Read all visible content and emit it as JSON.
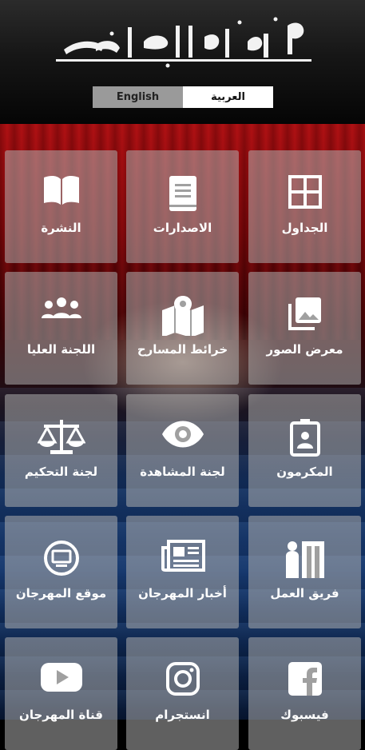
{
  "header": {
    "logo_text": "مهرجان القاهرة الدولي للمسرح التجريبي"
  },
  "language": {
    "english_label": "English",
    "arabic_label": "العربية",
    "selected": "العربية"
  },
  "tiles": [
    {
      "label": "الجداول",
      "icon": "grid-icon"
    },
    {
      "label": "الاصدارات",
      "icon": "book-icon"
    },
    {
      "label": "النشرة",
      "icon": "open-book-icon"
    },
    {
      "label": "معرض الصور",
      "icon": "photo-icon"
    },
    {
      "label": "خرائط المسارح",
      "icon": "map-icon"
    },
    {
      "label": "اللجنة العليا",
      "icon": "group-icon"
    },
    {
      "label": "المكرمون",
      "icon": "badge-icon"
    },
    {
      "label": "لجنة المشاهدة",
      "icon": "eye-icon"
    },
    {
      "label": "لجنة التحكيم",
      "icon": "scales-icon"
    },
    {
      "label": "فريق العمل",
      "icon": "team-door-icon"
    },
    {
      "label": "أخبار المهرجان",
      "icon": "newspaper-icon"
    },
    {
      "label": "موقع المهرجان",
      "icon": "monitor-icon"
    },
    {
      "label": "فيسبوك",
      "icon": "facebook-icon"
    },
    {
      "label": "انستجرام",
      "icon": "instagram-icon"
    },
    {
      "label": "قناة المهرجان",
      "icon": "youtube-icon"
    }
  ],
  "colors": {
    "tile_bg": "#afafaf",
    "curtain_red": "#a90d10",
    "seats_blue": "#14356a"
  }
}
